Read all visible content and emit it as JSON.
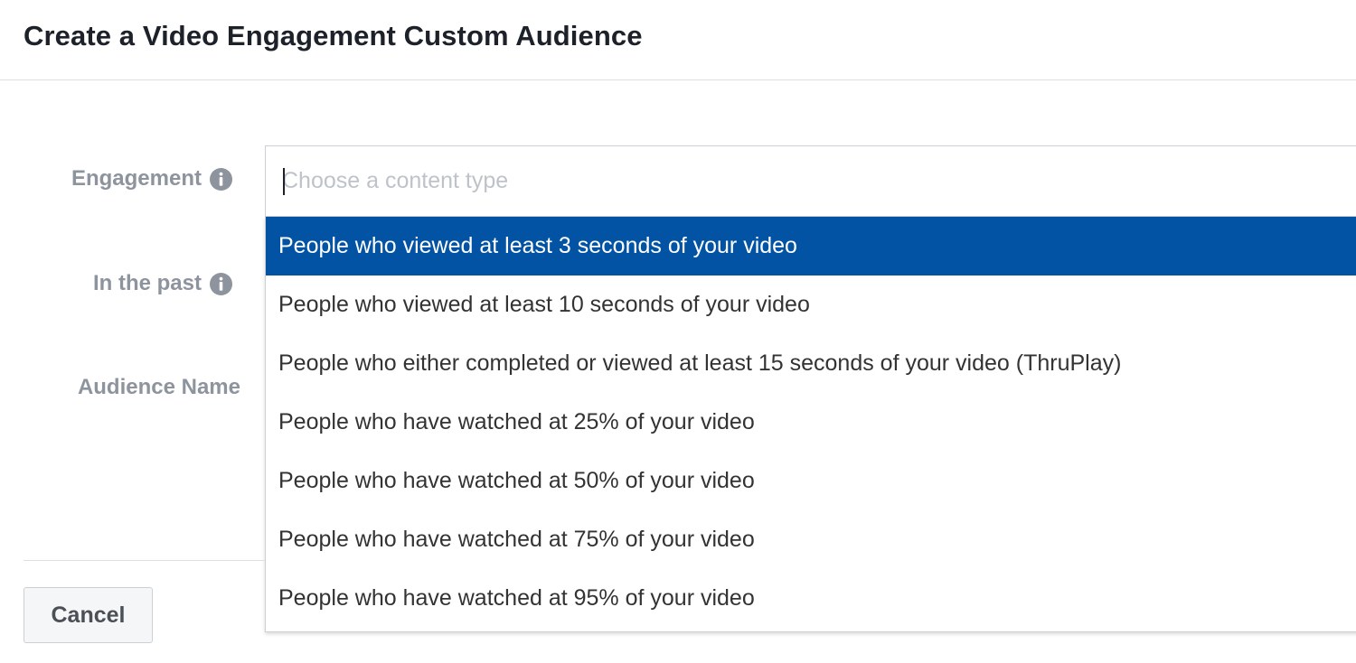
{
  "dialog": {
    "title": "Create a Video Engagement Custom Audience"
  },
  "form": {
    "engagement_label": "Engagement",
    "past_label": "In the past",
    "audience_name_label": "Audience Name",
    "info_icon": "info-circle-icon"
  },
  "content_type": {
    "value": "",
    "placeholder": "Choose a content type",
    "options": [
      "People who viewed at least 3 seconds of your video",
      "People who viewed at least 10 seconds of your video",
      "People who either completed or viewed at least 15 seconds of your video (ThruPlay)",
      "People who have watched at 25% of your video",
      "People who have watched at 50% of your video",
      "People who have watched at 75% of your video",
      "People who have watched at 95% of your video"
    ],
    "highlighted_index": 0
  },
  "footer": {
    "cancel_label": "Cancel"
  },
  "colors": {
    "highlight": "#0353a4",
    "label": "#8d949e",
    "title": "#1d2129"
  }
}
